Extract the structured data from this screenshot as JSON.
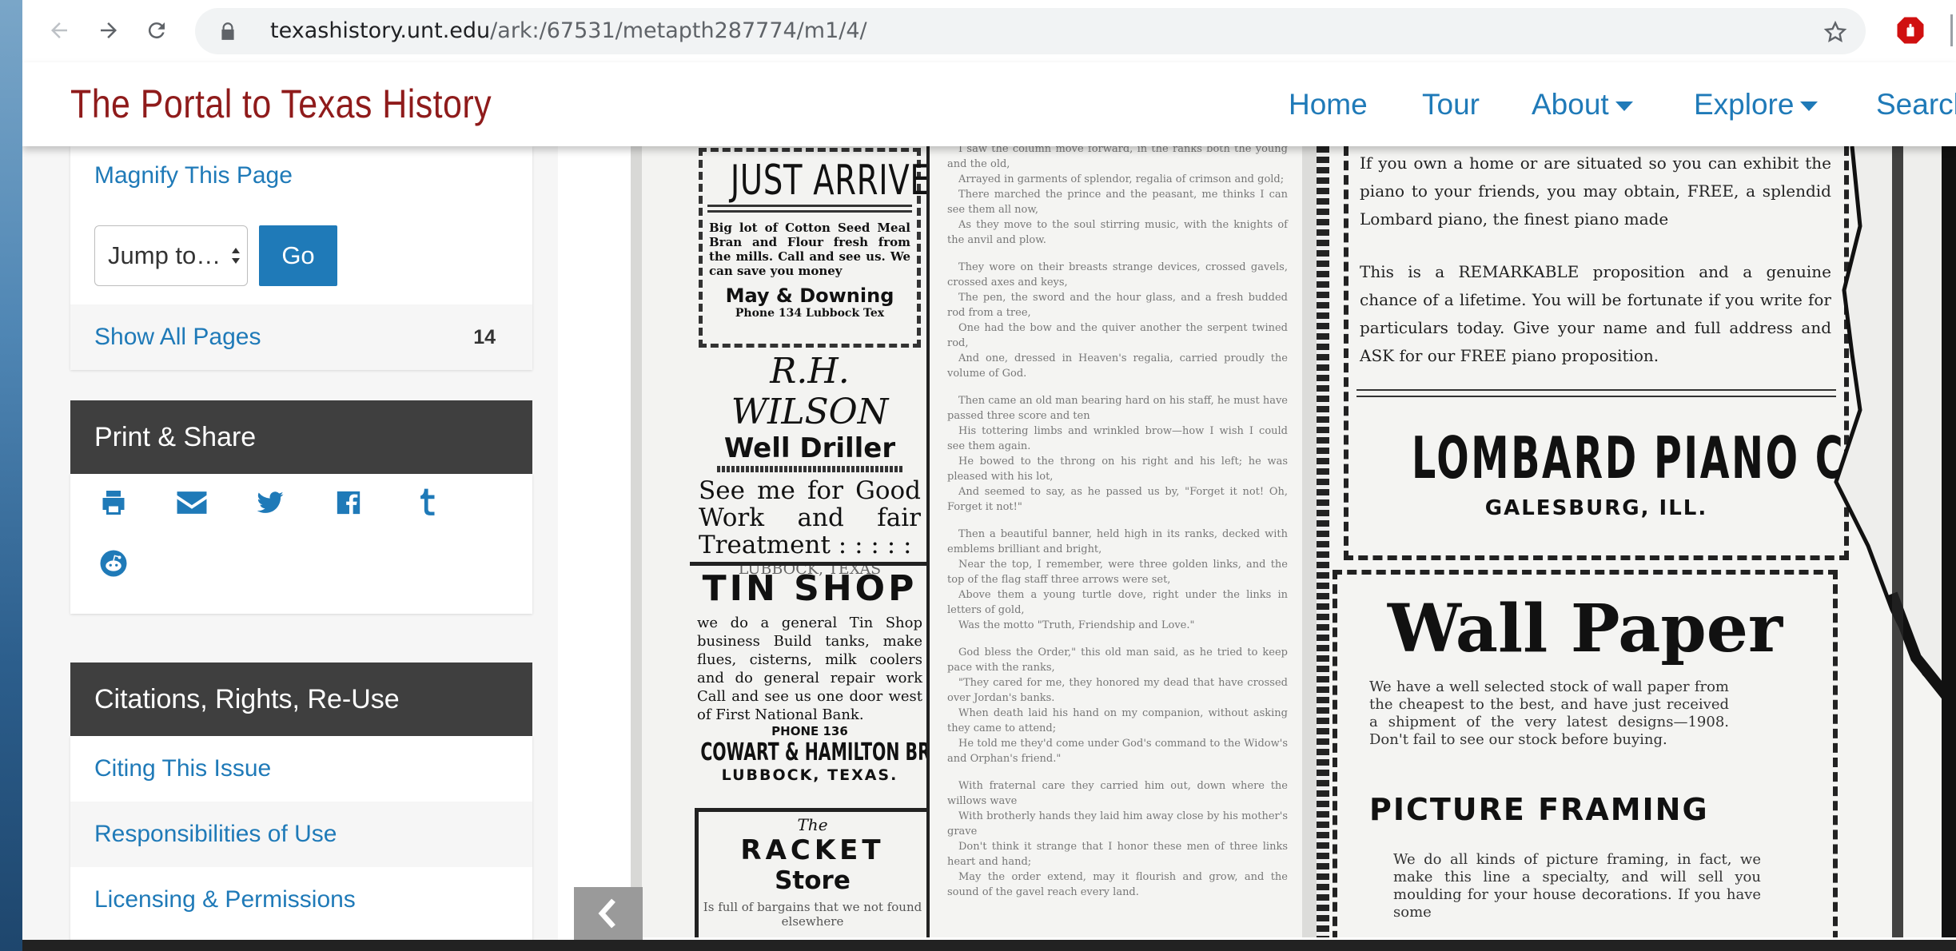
{
  "browser": {
    "url_host": "texashistory.unt.edu",
    "url_path": "/ark:/67531/metapth287774/m1/4/"
  },
  "site": {
    "title": "The Portal to Texas History",
    "nav": {
      "home": "Home",
      "tour": "Tour",
      "about": "About",
      "explore": "Explore",
      "search": "Search"
    }
  },
  "sidebar": {
    "magnify": "Magnify This Page",
    "jump_placeholder": "Jump to…",
    "go": "Go",
    "show_all_pages": "Show All Pages",
    "page_count": "14",
    "print_share": {
      "heading": "Print & Share",
      "icons": [
        "print-icon",
        "email-icon",
        "twitter-icon",
        "facebook-icon",
        "tumblr-icon",
        "reddit-icon"
      ]
    },
    "citations": {
      "heading": "Citations, Rights, Re-Use",
      "items": [
        "Citing This Issue",
        "Responsibilities of Use",
        "Licensing & Permissions"
      ]
    }
  },
  "newspaper": {
    "just_arrived": {
      "title": "JUST ARRIVED",
      "body": "Big lot of Cotton Seed Meal Bran and Flour fresh from the mills. Call and see us. We can save you money",
      "firm": "May & Downing",
      "address": "Phone 134     Lubbock Tex"
    },
    "wilson": {
      "name": "R.H. WILSON",
      "trade": "Well Driller",
      "body": "See me for Good Work and fair Treatment : : : : :",
      "city": "LUBBOCK, TEXAS"
    },
    "tin_shop": {
      "title": "TIN SHOP",
      "body": "we do a general Tin Shop business Build tanks, make flues, cisterns, milk coolers and do general repair work Call and see us one door west of First National Bank.",
      "phone": "PHONE 136",
      "firm": "COWART & HAMILTON BROS.",
      "city": "LUBBOCK, TEXAS."
    },
    "racket": {
      "the": "The",
      "title": "RACKET",
      "sub": "Store",
      "body": "Is full of bargains that we not found elsewhere"
    },
    "poem": [
      "I saw the column move forward, in the ranks both the young and the old,",
      "Arrayed in garments of splendor, regalia of crimson and gold;",
      "There marched the prince and the peasant, me thinks I can see them all now,",
      "As they move to the soul stirring music, with the knights of the anvil and plow.",
      "They wore on their breasts strange devices, crossed gavels, crossed axes and keys,",
      "The pen, the sword and the hour glass, and a fresh budded rod from a tree,",
      "One had the bow and the quiver another the serpent twined rod,",
      "And one, dressed in Heaven's regalia, carried proudly the volume of God.",
      "Then came an old man bearing hard on his staff, he must have passed three score and ten",
      "His tottering limbs and wrinkled brow—how I wish I could see them again.",
      "He bowed to the throng on his right and his left; he was pleased with his lot,",
      "And seemed to say, as he passed us by, \"Forget it not! Oh, Forget it not!\"",
      "Then a beautiful banner, held high in its ranks, decked with emblems brilliant and bright,",
      "Near the top, I remember, were three golden links, and the top of the flag staff three arrows were set,",
      "Above them a young turtle dove, right under the links in letters of gold,",
      "Was the motto \"Truth, Friendship and Love.\"",
      "God bless the Order,\" this old man said, as he tried to keep pace with the ranks,",
      "\"They cared for me, they honored my dead that have crossed over Jordan's banks.",
      "When death laid his hand on my companion, without asking they came to attend;",
      "He told me they'd come under God's command to the Widow's and Orphan's friend.\"",
      "With fraternal care they carried him out, down where the willows wave",
      "With brotherly hands they laid him away close by his mother's grave",
      "Don't think it strange that I honor these men of three links heart and hand;",
      "May the order extend, may it flourish and grow, and the sound of the gavel reach every land."
    ],
    "lombard": {
      "p1": "If you own a home or are situated so you can exhibit the piano to your friends, you may obtain, FREE, a splendid Lombard piano, the finest piano made",
      "p2": "This is a REMARKABLE proposition and a genuine chance of a lifetime. You will be fortunate if you write for particulars today. Give your name and full address and ASK for our FREE piano proposition.",
      "name": "LOMBARD PIANO CO.",
      "city": "GALESBURG, ILL."
    },
    "wallpaper": {
      "title": "Wall Paper",
      "body": "We have a well selected stock of wall paper from the cheapest to the best, and have just received a shipment of the very latest designs—1908. Don't fail to see our stock before buying.",
      "sub": "PICTURE FRAMING",
      "body2": "We do all kinds of picture framing, in fact, we make this line a specialty, and will sell you moulding for your house decorations. If you have some"
    }
  }
}
